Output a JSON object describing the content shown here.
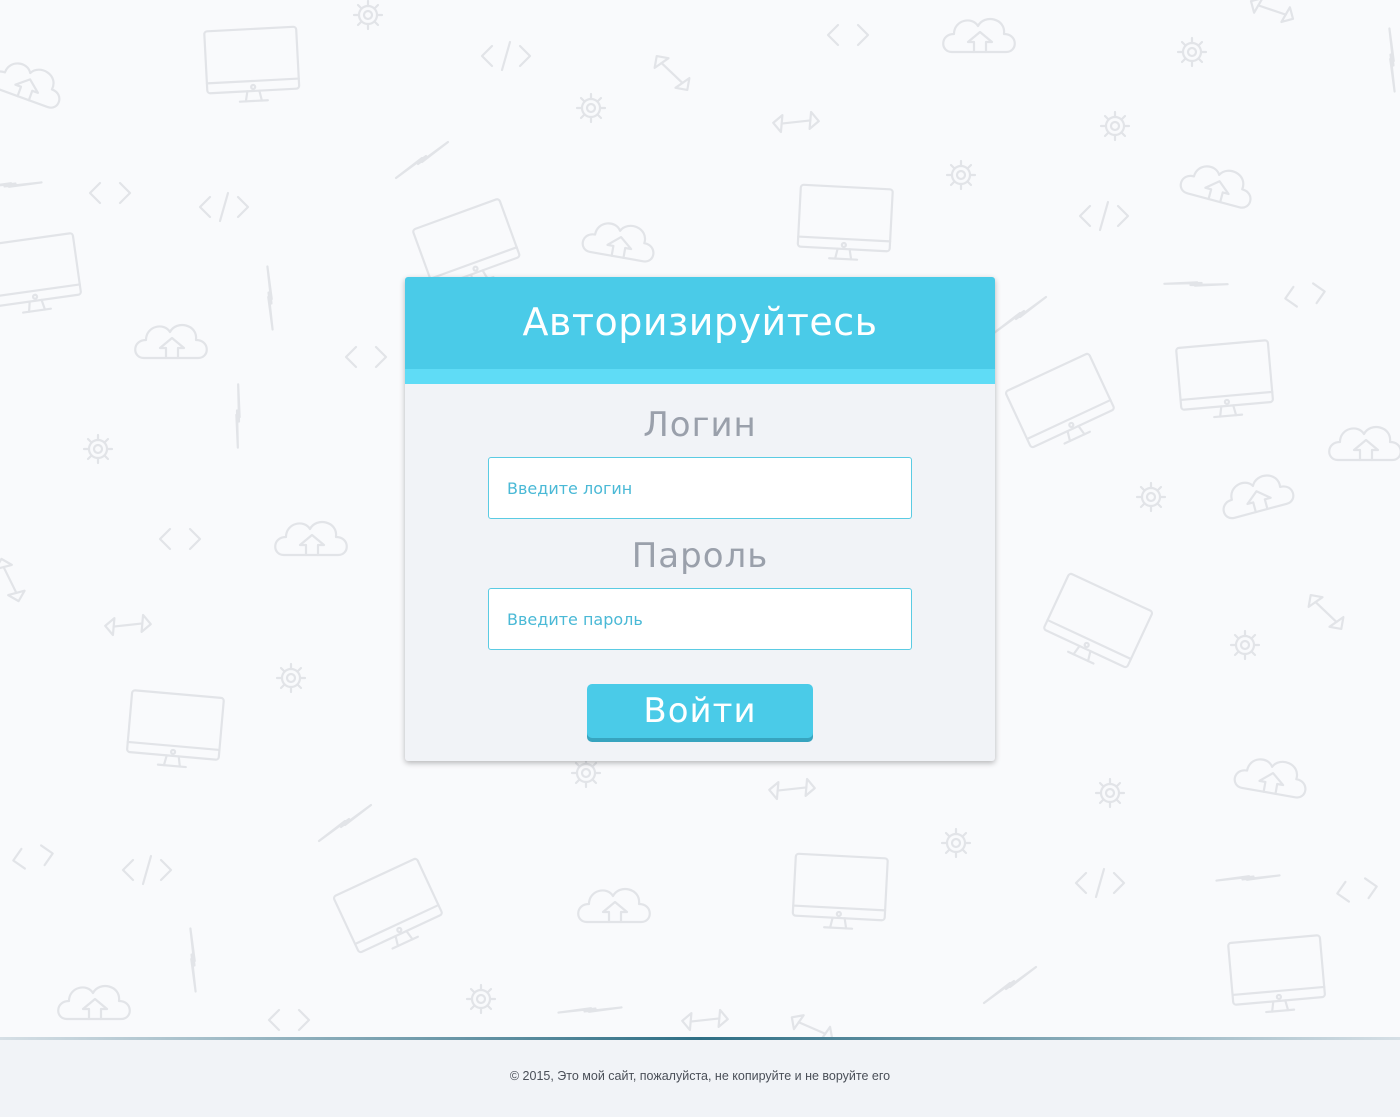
{
  "login_card": {
    "title": "Авторизируйтесь",
    "login_label": "Логин",
    "login_placeholder": "Введите логин",
    "password_label": "Пароль",
    "password_placeholder": "Введите пароль",
    "submit_label": "Войти"
  },
  "footer": {
    "copyright": "© 2015, Это мой сайт, пожалуйста, не копируйте и не воруйте его"
  },
  "background": {
    "pattern_icons": [
      "monitor-icon",
      "cloud-upload-icon",
      "gear-icon",
      "code-brackets-icon",
      "lightning-icon",
      "arrows-icon"
    ]
  },
  "colors": {
    "accent": "#4acbe8",
    "accent_light": "#5fdcf6",
    "card_background": "#f1f3f7",
    "label_text": "#9aa0ab",
    "input_text": "#4ab9d6",
    "page_background": "#f9fafc"
  }
}
